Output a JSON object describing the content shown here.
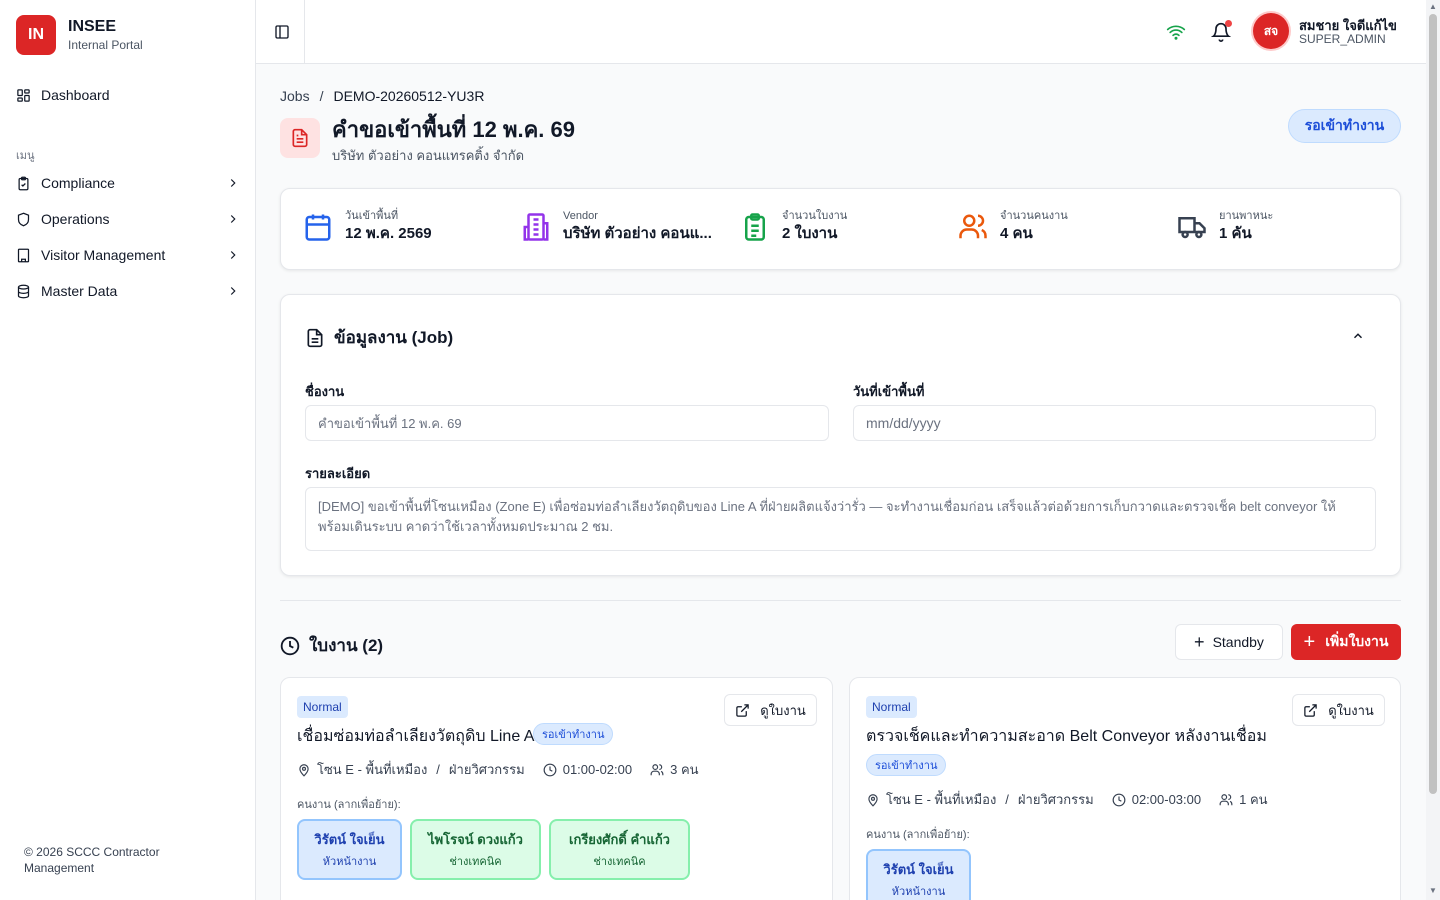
{
  "brand": {
    "logo": "IN",
    "name": "INSEE",
    "sub": "Internal Portal"
  },
  "sidebar": {
    "dashboard": "Dashboard",
    "menu_label": "เมนู",
    "items": [
      {
        "label": "Compliance",
        "icon": "clipboard-check-icon"
      },
      {
        "label": "Operations",
        "icon": "shield-icon"
      },
      {
        "label": "Visitor Management",
        "icon": "building-icon"
      },
      {
        "label": "Master Data",
        "icon": "database-icon"
      }
    ],
    "footer": "© 2026 SCCC Contractor Management"
  },
  "header": {
    "avatar_initials": "สจ",
    "user_name": "สมชาย ใจดีแก้ไข",
    "user_role": "SUPER_ADMIN"
  },
  "breadcrumb": {
    "root": "Jobs",
    "sep": "/",
    "current": "DEMO-20260512-YU3R"
  },
  "page": {
    "title": "คำขอเข้าพื้นที่ 12 พ.ค. 69",
    "subtitle": "บริษัท ตัวอย่าง คอนแทรคติ้ง จำกัด",
    "status": "รอเข้าทำงาน"
  },
  "stats": [
    {
      "label": "วันเข้าพื้นที่",
      "value": "12 พ.ค. 2569",
      "icon": "calendar-icon",
      "color": "#2563eb"
    },
    {
      "label": "Vendor",
      "value": "บริษัท ตัวอย่าง คอนแ...",
      "icon": "building-icon",
      "color": "#9333ea"
    },
    {
      "label": "จำนวนใบงาน",
      "value": "2 ใบงาน",
      "icon": "clipboard-list-icon",
      "color": "#16a34a"
    },
    {
      "label": "จำนวนคนงาน",
      "value": "4 คน",
      "icon": "users-icon",
      "color": "#ea580c"
    },
    {
      "label": "ยานพาหนะ",
      "value": "1 คัน",
      "icon": "truck-icon",
      "color": "#374151"
    }
  ],
  "job_info": {
    "title": "ข้อมูลงาน (Job)",
    "name_label": "ชื่องาน",
    "name_placeholder": "คำขอเข้าพื้นที่ 12 พ.ค. 69",
    "date_label": "วันที่เข้าพื้นที่",
    "date_placeholder": "mm/dd/yyyy",
    "detail_label": "รายละเอียด",
    "detail_value": "[DEMO] ขอเข้าพื้นที่โซนเหมือง (Zone E) เพื่อซ่อมท่อลำเลียงวัตถุดิบของ Line A ที่ฝ่ายผลิตแจ้งว่ารั่ว — จะทำงานเชื่อมก่อน เสร็จแล้วต่อด้วยการเก็บกวาดและตรวจเช็ค belt conveyor ให้พร้อมเดินระบบ คาดว่าใช้เวลาทั้งหมดประมาณ 2 ชม."
  },
  "worksheets": {
    "title": "ใบงาน (2)",
    "standby_label": "Standby",
    "add_label": "เพิ่มใบงาน",
    "view_label": "ดูใบงาน",
    "workers_label": "คนงาน (ลากเพื่อย้าย):",
    "items": [
      {
        "priority": "Normal",
        "title": "เชื่อมซ่อมท่อลำเลียงวัตถุดิบ Line A",
        "status": "รอเข้าทำงาน",
        "location": "โซน E - พื้นที่เหมือง",
        "sep": "/",
        "department": "ฝ่ายวิศวกรรม",
        "time": "01:00-02:00",
        "people": "3 คน",
        "workers": [
          {
            "name": "วิรัตน์ ใจเย็น",
            "role": "หัวหน้างาน"
          },
          {
            "name": "ไพโรจน์ ดวงแก้ว",
            "role": "ช่างเทคนิค"
          },
          {
            "name": "เกรียงศักดิ์ คำแก้ว",
            "role": "ช่างเทคนิค"
          }
        ]
      },
      {
        "priority": "Normal",
        "title": "ตรวจเช็คและทำความสะอาด Belt Conveyor หลังงานเชื่อม",
        "status": "รอเข้าทำงาน",
        "location": "โซน E - พื้นที่เหมือง",
        "sep": "/",
        "department": "ฝ่ายวิศวกรรม",
        "time": "02:00-03:00",
        "people": "1 คน",
        "workers": [
          {
            "name": "วิรัตน์ ใจเย็น",
            "role": "หัวหน้างาน"
          }
        ]
      }
    ]
  },
  "colors": {
    "brand": "#dc2626",
    "status_blue": "#1d4ed8"
  }
}
